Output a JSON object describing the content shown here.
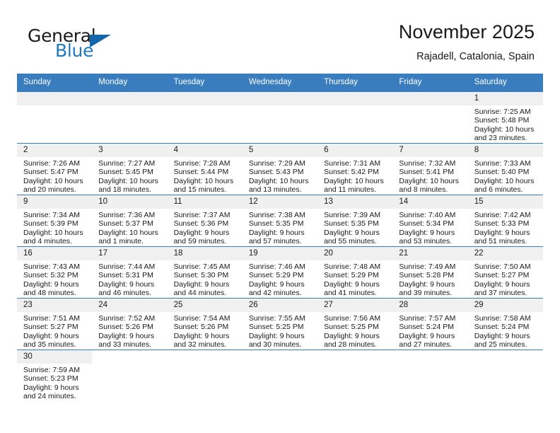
{
  "brand": {
    "name_part1": "General",
    "name_part2": "Blue",
    "triangle_color": "#1266ab",
    "blue_color": "#1f7ac0"
  },
  "header": {
    "title": "November 2025",
    "location": "Rajadell, Catalonia, Spain"
  },
  "theme": {
    "header_bg": "#3a7dbf",
    "daynum_bg": "#f0f0f0",
    "grid_line": "#3a7dbf",
    "text": "#1a1a1a"
  },
  "calendar": {
    "weekday_headers": [
      "Sunday",
      "Monday",
      "Tuesday",
      "Wednesday",
      "Thursday",
      "Friday",
      "Saturday"
    ],
    "weeks": [
      [
        {
          "type": "blank"
        },
        {
          "type": "blank"
        },
        {
          "type": "blank"
        },
        {
          "type": "blank"
        },
        {
          "type": "blank"
        },
        {
          "type": "blank"
        },
        {
          "type": "day",
          "day": "1",
          "sunrise": "Sunrise: 7:25 AM",
          "sunset": "Sunset: 5:48 PM",
          "daylight1": "Daylight: 10 hours",
          "daylight2": "and 23 minutes."
        }
      ],
      [
        {
          "type": "day",
          "day": "2",
          "sunrise": "Sunrise: 7:26 AM",
          "sunset": "Sunset: 5:47 PM",
          "daylight1": "Daylight: 10 hours",
          "daylight2": "and 20 minutes."
        },
        {
          "type": "day",
          "day": "3",
          "sunrise": "Sunrise: 7:27 AM",
          "sunset": "Sunset: 5:45 PM",
          "daylight1": "Daylight: 10 hours",
          "daylight2": "and 18 minutes."
        },
        {
          "type": "day",
          "day": "4",
          "sunrise": "Sunrise: 7:28 AM",
          "sunset": "Sunset: 5:44 PM",
          "daylight1": "Daylight: 10 hours",
          "daylight2": "and 15 minutes."
        },
        {
          "type": "day",
          "day": "5",
          "sunrise": "Sunrise: 7:29 AM",
          "sunset": "Sunset: 5:43 PM",
          "daylight1": "Daylight: 10 hours",
          "daylight2": "and 13 minutes."
        },
        {
          "type": "day",
          "day": "6",
          "sunrise": "Sunrise: 7:31 AM",
          "sunset": "Sunset: 5:42 PM",
          "daylight1": "Daylight: 10 hours",
          "daylight2": "and 11 minutes."
        },
        {
          "type": "day",
          "day": "7",
          "sunrise": "Sunrise: 7:32 AM",
          "sunset": "Sunset: 5:41 PM",
          "daylight1": "Daylight: 10 hours",
          "daylight2": "and 8 minutes."
        },
        {
          "type": "day",
          "day": "8",
          "sunrise": "Sunrise: 7:33 AM",
          "sunset": "Sunset: 5:40 PM",
          "daylight1": "Daylight: 10 hours",
          "daylight2": "and 6 minutes."
        }
      ],
      [
        {
          "type": "day",
          "day": "9",
          "sunrise": "Sunrise: 7:34 AM",
          "sunset": "Sunset: 5:39 PM",
          "daylight1": "Daylight: 10 hours",
          "daylight2": "and 4 minutes."
        },
        {
          "type": "day",
          "day": "10",
          "sunrise": "Sunrise: 7:36 AM",
          "sunset": "Sunset: 5:37 PM",
          "daylight1": "Daylight: 10 hours",
          "daylight2": "and 1 minute."
        },
        {
          "type": "day",
          "day": "11",
          "sunrise": "Sunrise: 7:37 AM",
          "sunset": "Sunset: 5:36 PM",
          "daylight1": "Daylight: 9 hours",
          "daylight2": "and 59 minutes."
        },
        {
          "type": "day",
          "day": "12",
          "sunrise": "Sunrise: 7:38 AM",
          "sunset": "Sunset: 5:35 PM",
          "daylight1": "Daylight: 9 hours",
          "daylight2": "and 57 minutes."
        },
        {
          "type": "day",
          "day": "13",
          "sunrise": "Sunrise: 7:39 AM",
          "sunset": "Sunset: 5:35 PM",
          "daylight1": "Daylight: 9 hours",
          "daylight2": "and 55 minutes."
        },
        {
          "type": "day",
          "day": "14",
          "sunrise": "Sunrise: 7:40 AM",
          "sunset": "Sunset: 5:34 PM",
          "daylight1": "Daylight: 9 hours",
          "daylight2": "and 53 minutes."
        },
        {
          "type": "day",
          "day": "15",
          "sunrise": "Sunrise: 7:42 AM",
          "sunset": "Sunset: 5:33 PM",
          "daylight1": "Daylight: 9 hours",
          "daylight2": "and 51 minutes."
        }
      ],
      [
        {
          "type": "day",
          "day": "16",
          "sunrise": "Sunrise: 7:43 AM",
          "sunset": "Sunset: 5:32 PM",
          "daylight1": "Daylight: 9 hours",
          "daylight2": "and 48 minutes."
        },
        {
          "type": "day",
          "day": "17",
          "sunrise": "Sunrise: 7:44 AM",
          "sunset": "Sunset: 5:31 PM",
          "daylight1": "Daylight: 9 hours",
          "daylight2": "and 46 minutes."
        },
        {
          "type": "day",
          "day": "18",
          "sunrise": "Sunrise: 7:45 AM",
          "sunset": "Sunset: 5:30 PM",
          "daylight1": "Daylight: 9 hours",
          "daylight2": "and 44 minutes."
        },
        {
          "type": "day",
          "day": "19",
          "sunrise": "Sunrise: 7:46 AM",
          "sunset": "Sunset: 5:29 PM",
          "daylight1": "Daylight: 9 hours",
          "daylight2": "and 42 minutes."
        },
        {
          "type": "day",
          "day": "20",
          "sunrise": "Sunrise: 7:48 AM",
          "sunset": "Sunset: 5:29 PM",
          "daylight1": "Daylight: 9 hours",
          "daylight2": "and 41 minutes."
        },
        {
          "type": "day",
          "day": "21",
          "sunrise": "Sunrise: 7:49 AM",
          "sunset": "Sunset: 5:28 PM",
          "daylight1": "Daylight: 9 hours",
          "daylight2": "and 39 minutes."
        },
        {
          "type": "day",
          "day": "22",
          "sunrise": "Sunrise: 7:50 AM",
          "sunset": "Sunset: 5:27 PM",
          "daylight1": "Daylight: 9 hours",
          "daylight2": "and 37 minutes."
        }
      ],
      [
        {
          "type": "day",
          "day": "23",
          "sunrise": "Sunrise: 7:51 AM",
          "sunset": "Sunset: 5:27 PM",
          "daylight1": "Daylight: 9 hours",
          "daylight2": "and 35 minutes."
        },
        {
          "type": "day",
          "day": "24",
          "sunrise": "Sunrise: 7:52 AM",
          "sunset": "Sunset: 5:26 PM",
          "daylight1": "Daylight: 9 hours",
          "daylight2": "and 33 minutes."
        },
        {
          "type": "day",
          "day": "25",
          "sunrise": "Sunrise: 7:54 AM",
          "sunset": "Sunset: 5:26 PM",
          "daylight1": "Daylight: 9 hours",
          "daylight2": "and 32 minutes."
        },
        {
          "type": "day",
          "day": "26",
          "sunrise": "Sunrise: 7:55 AM",
          "sunset": "Sunset: 5:25 PM",
          "daylight1": "Daylight: 9 hours",
          "daylight2": "and 30 minutes."
        },
        {
          "type": "day",
          "day": "27",
          "sunrise": "Sunrise: 7:56 AM",
          "sunset": "Sunset: 5:25 PM",
          "daylight1": "Daylight: 9 hours",
          "daylight2": "and 28 minutes."
        },
        {
          "type": "day",
          "day": "28",
          "sunrise": "Sunrise: 7:57 AM",
          "sunset": "Sunset: 5:24 PM",
          "daylight1": "Daylight: 9 hours",
          "daylight2": "and 27 minutes."
        },
        {
          "type": "day",
          "day": "29",
          "sunrise": "Sunrise: 7:58 AM",
          "sunset": "Sunset: 5:24 PM",
          "daylight1": "Daylight: 9 hours",
          "daylight2": "and 25 minutes."
        }
      ],
      [
        {
          "type": "day",
          "day": "30",
          "sunrise": "Sunrise: 7:59 AM",
          "sunset": "Sunset: 5:23 PM",
          "daylight1": "Daylight: 9 hours",
          "daylight2": "and 24 minutes."
        },
        {
          "type": "blank"
        },
        {
          "type": "blank"
        },
        {
          "type": "blank"
        },
        {
          "type": "blank"
        },
        {
          "type": "blank"
        },
        {
          "type": "blank"
        }
      ]
    ]
  }
}
